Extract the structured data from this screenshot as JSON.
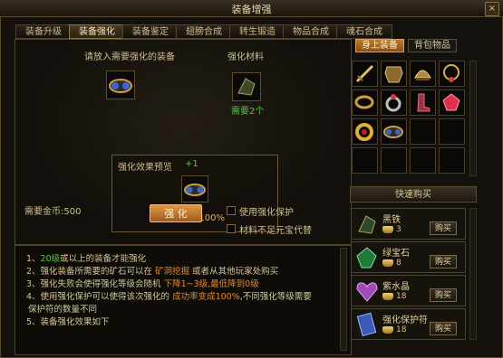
{
  "window": {
    "title": "装备增强",
    "close_icon": "×"
  },
  "tabs": [
    {
      "label": "装备升级"
    },
    {
      "label": "装备强化",
      "active": true
    },
    {
      "label": "装备鉴定"
    },
    {
      "label": "翅膀合成"
    },
    {
      "label": "转生锻造"
    },
    {
      "label": "物品合成"
    },
    {
      "label": "魂石合成"
    }
  ],
  "strengthen": {
    "equip_prompt": "请放入需要强化的装备",
    "material_label": "强化材料",
    "material_need": "需要2个",
    "preview_title": "强化效果预览",
    "preview_bonus": "+1",
    "success_rate": "成功率:100%",
    "gold_label": "需要金币:500",
    "button_label": "强 化",
    "opt_protect": "使用强化保护",
    "opt_yuanbao": "材料不足元宝代替"
  },
  "info_lines": [
    {
      "pre": "1、",
      "g": "20级",
      "post": "或以上的装备才能强化"
    },
    {
      "pre": "2、强化装备所需要的矿石可以在 ",
      "o": "矿洞挖掘",
      "post": " 或者从其他玩家处购买"
    },
    {
      "pre": "3、强化失败会使得强化等级会随机 ",
      "o": "下降1~3级,最低降到0级",
      "post": ""
    },
    {
      "pre": "4、使用强化保护可以使得该次强化的 ",
      "o": "成功率变成100%",
      "post": ",不同强化等级需要"
    },
    {
      "pre": "保护符的数量不同",
      "post": ""
    },
    {
      "pre": "5、装备强化效果如下",
      "post": ""
    }
  ],
  "right_tabs": {
    "equipped": "身上装备",
    "bag": "背包物品"
  },
  "shop": {
    "title": "快速购买",
    "items": [
      {
        "name": "黑铁",
        "price": "3",
        "buy": "购买",
        "icon": "black-iron-icon",
        "color": "#2c4a2a"
      },
      {
        "name": "绿宝石",
        "price": "8",
        "buy": "购买",
        "icon": "emerald-icon",
        "color": "#1f7a3a"
      },
      {
        "name": "紫水晶",
        "price": "18",
        "buy": "购买",
        "icon": "amethyst-icon",
        "color": "#a04ab8"
      },
      {
        "name": "强化保护符",
        "price": "18",
        "buy": "购买",
        "icon": "protect-talisman-icon",
        "color": "#3a5ab8"
      }
    ]
  },
  "colors": {
    "accent_green": "#4ecc3c",
    "accent_orange": "#e08a30",
    "button_orange": "#d08a3a"
  }
}
